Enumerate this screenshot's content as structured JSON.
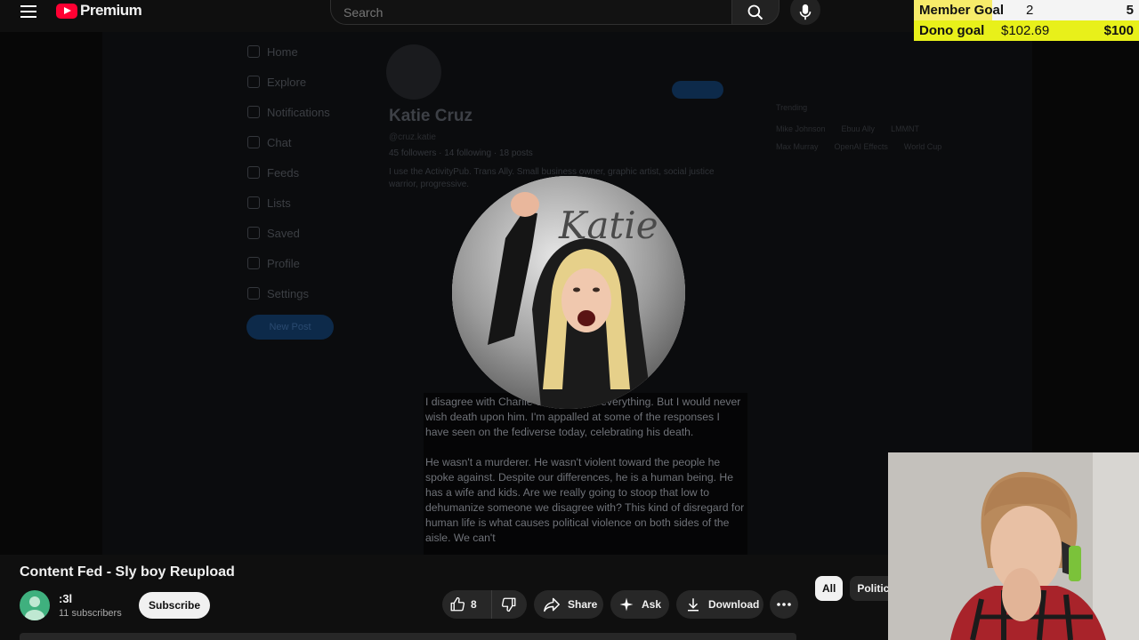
{
  "header": {
    "brand": "Premium",
    "search_placeholder": "Search"
  },
  "goals": {
    "member": {
      "label": "Member Goal",
      "current": "2",
      "target": "5"
    },
    "dono": {
      "label": "Dono goal",
      "current": "$102.69",
      "target": "$100"
    }
  },
  "video_content": {
    "nav": [
      "Home",
      "Explore",
      "Notifications",
      "Chat",
      "Feeds",
      "Lists",
      "Saved",
      "Profile",
      "Settings"
    ],
    "new_post": "New Post",
    "profile_name": "Katie Cruz",
    "handle": "@cruz.katie",
    "stats": "45 followers · 14 following · 18 posts",
    "bio": "I use the ActivityPub. Trans Ally. Small business owner, graphic artist, social justice warrior, progressive.",
    "follow": "+ Follow",
    "trending_label": "Trending",
    "trending": [
      "Mike Johnson",
      "Ebuu Ally",
      "LMMNT",
      "Max Murray",
      "OpenAI Effects",
      "World Cup"
    ],
    "post_paragraph_1": "I disagree with Charlie on just about everything. But I would never wish death upon him. I'm appalled at some of the responses I have seen on the fediverse today, celebrating his death.",
    "post_paragraph_2": "He wasn't a murderer. He wasn't violent toward the people he spoke against. Despite our differences, he is a human being. He has a wife and kids. Are we really going to stoop that low to dehumanize someone we disagree with? This kind of disregard for human life is what causes political violence on both sides of the aisle. We can't",
    "photo_signature": "Katie"
  },
  "video_info": {
    "title": "Content Fed - Sly boy Reupload",
    "channel_name": ":3l",
    "subscribers": "11 subscribers",
    "subscribe": "Subscribe",
    "likes": "8",
    "share": "Share",
    "ask": "Ask",
    "download": "Download"
  },
  "chips": [
    "All",
    "Politic"
  ],
  "colors": {
    "youtube_red": "#ff0033",
    "member_goal_bg": "#f7ec6a",
    "dono_goal_bg": "#e8f01a"
  }
}
